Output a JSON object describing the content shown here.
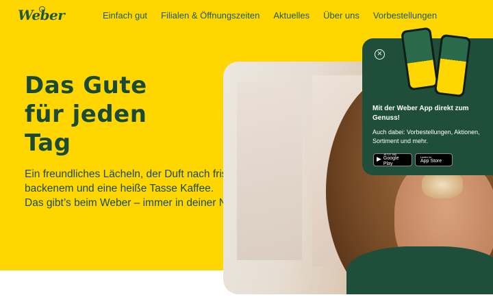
{
  "logo": {
    "text": "Weber"
  },
  "nav": {
    "items": [
      "Einfach gut",
      "Filialen & Öffnungszeiten",
      "Aktuelles",
      "Über uns",
      "Vorbestellungen"
    ]
  },
  "hero": {
    "headline": [
      "Das Gute",
      "für jeden",
      "Tag"
    ],
    "subtext": [
      "Ein freundliches Lächeln, der Duft nach frisch Ge-",
      "backenem und eine heiße Tasse Kaffee.",
      "Das gibt’s beim Weber – immer in deiner Nähe."
    ]
  },
  "app_popup": {
    "title": "Mit der Weber App direkt zum Genuss!",
    "description": "Auch dabei: Vorbestellungen, Aktionen, Sortiment und mehr.",
    "close_icon": "×",
    "google_play": {
      "small": "JETZT BEI",
      "big": "Google Play",
      "icon": "▶"
    },
    "app_store": {
      "small": "Laden im",
      "big": "App Store",
      "icon": ""
    }
  },
  "colors": {
    "brand_yellow": "#ffd600",
    "brand_green": "#1f4f3a",
    "text_green": "#1a4a32"
  }
}
